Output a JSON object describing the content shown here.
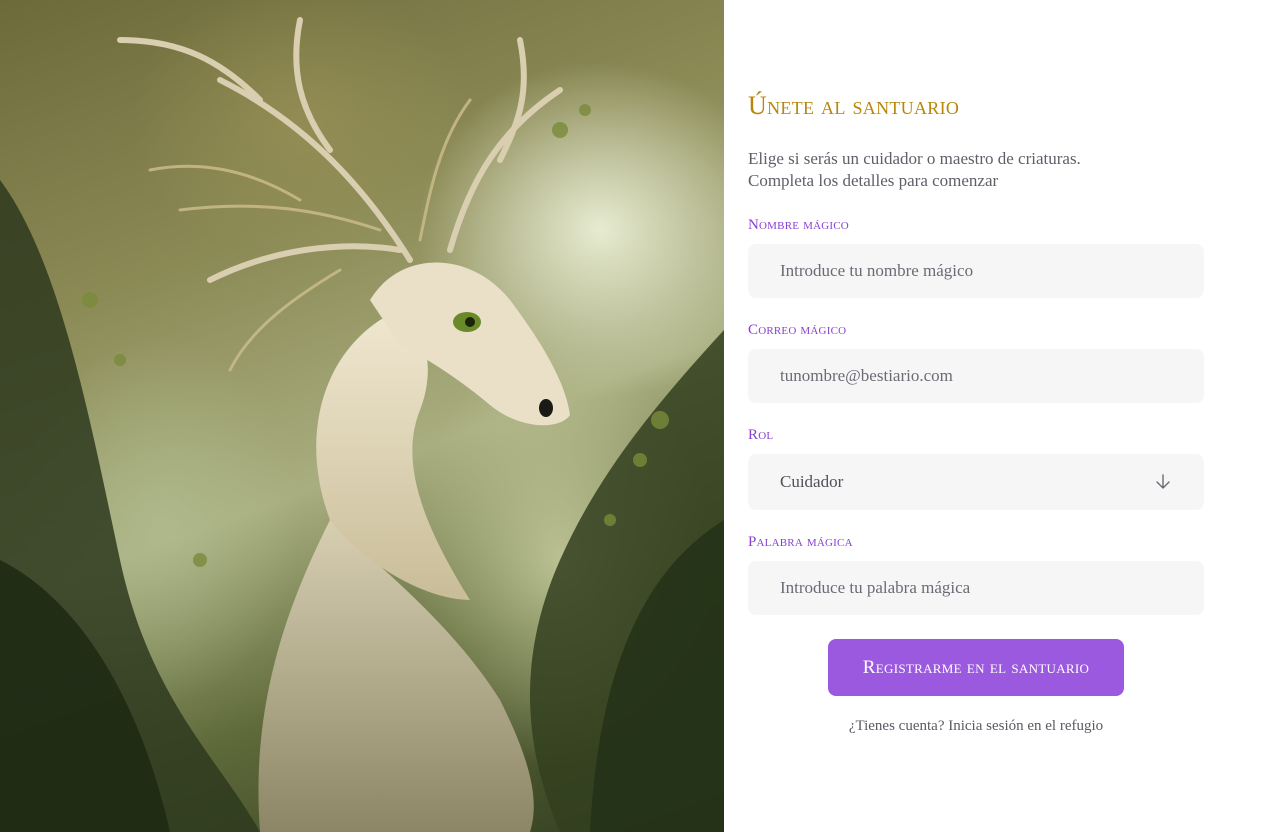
{
  "colors": {
    "title": "#b8860b",
    "label": "#8a3fd1",
    "button_bg": "#9b59e0"
  },
  "hero": {
    "subject": "feathered-dragon-illustration"
  },
  "form": {
    "title": "Únete al santuario",
    "subtitle_line1": "Elige si serás un cuidador o maestro de criaturas.",
    "subtitle_line2": "Completa los detalles para comenzar",
    "name": {
      "label": "Nombre mágico",
      "placeholder": "Introduce tu nombre mágico"
    },
    "email": {
      "label": "Correo mágico",
      "placeholder": "tunombre@bestiario.com"
    },
    "role": {
      "label": "Rol",
      "value": "Cuidador",
      "icon": "arrow-down-icon"
    },
    "password": {
      "label": "Palabra mágica",
      "placeholder": "Introduce tu palabra mágica"
    },
    "submit_label": "Registrarme en el santuario",
    "login_prompt": "¿Tienes cuenta? Inicia sesión en el refugio"
  }
}
